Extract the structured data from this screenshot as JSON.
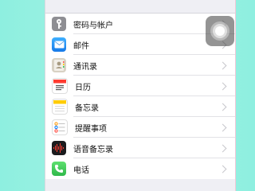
{
  "settings": {
    "items": [
      {
        "label": "密码与帐户",
        "icon": "key-icon",
        "color": "#8e8e93"
      },
      {
        "label": "邮件",
        "icon": "mail-icon",
        "color": "#1e90ff"
      },
      {
        "label": "通讯录",
        "icon": "contacts-icon",
        "color": "#b0a48c"
      },
      {
        "label": "日历",
        "icon": "calendar-icon",
        "color": "#ff3b30"
      },
      {
        "label": "备忘录",
        "icon": "notes-icon",
        "color": "#ffcc00"
      },
      {
        "label": "提醒事项",
        "icon": "reminders-icon",
        "color": "#ff9500"
      },
      {
        "label": "语音备忘录",
        "icon": "voice-memos-icon",
        "color": "#1c1c1e"
      },
      {
        "label": "电话",
        "icon": "phone-icon",
        "color": "#34c759"
      }
    ]
  },
  "colors": {
    "background": "#9df0e0",
    "screen": "#efeff4",
    "chevron": "#c7c7cc"
  }
}
